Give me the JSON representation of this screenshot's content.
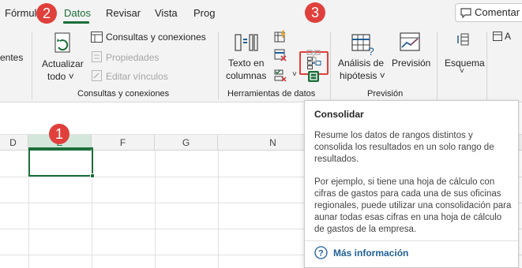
{
  "tabs": [
    {
      "label": "Fórmulas",
      "active": false
    },
    {
      "label": "Datos",
      "active": true
    },
    {
      "label": "Revisar",
      "active": false
    },
    {
      "label": "Vista",
      "active": false
    },
    {
      "label": "Prog",
      "active": false
    }
  ],
  "comment_button": "Comentar",
  "ribbon": {
    "partial_left_label": "entes",
    "refresh": {
      "line1": "Actualizar",
      "line2": "todo ˅"
    },
    "connections": {
      "queries": "Consultas y conexiones",
      "properties": "Propiedades",
      "edit_links": "Editar vínculos",
      "group": "Consultas y conexiones"
    },
    "data_tools": {
      "text_to_columns_line1": "Texto en",
      "text_to_columns_line2": "columnas",
      "group": "Herramientas de datos"
    },
    "forecast": {
      "whatif_line1": "Análisis de",
      "whatif_line2": "hipótesis ˅",
      "forecast_sheet": "Previsión",
      "group": "Previsión"
    },
    "outline": {
      "label": "Esquema",
      "chevron": "˅"
    },
    "partial_right": "A"
  },
  "badges": {
    "one": "1",
    "two": "2",
    "three": "3"
  },
  "columns": [
    "D",
    "E",
    "F",
    "G",
    "N"
  ],
  "tooltip": {
    "title": "Consolidar",
    "p1": "Resume los datos de rangos distintos y consolida los resultados en un solo rango de resultados.",
    "p2": "Por ejemplo, si tiene una hoja de cálculo con cifras de gastos para cada una de sus oficinas regionales, puede utilizar una consolidación para aunar todas esas cifras en una hoja de cálculo de gastos de la empresa.",
    "link": "Más información"
  },
  "colors": {
    "accent": "#1b6e3a",
    "badge": "#e0403c",
    "link": "#1f5f99"
  }
}
